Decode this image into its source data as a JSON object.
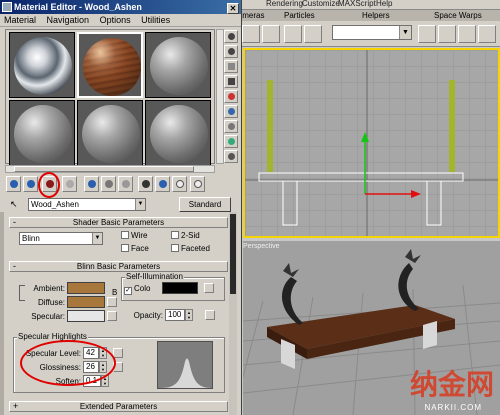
{
  "max": {
    "menubar": [
      "Rendering",
      "Customize",
      "MAXScript",
      "Help"
    ],
    "tabs": [
      "Cameras",
      "Particles",
      "Helpers",
      "Space Warps"
    ],
    "persp_label": "Perspective",
    "watermark_cn": "纳金网",
    "watermark_url": "NARKII.COM"
  },
  "material_editor": {
    "title": "Material Editor - Wood_Ashen",
    "menu": [
      "Material",
      "Navigation",
      "Options",
      "Utilities"
    ],
    "material_name": "Wood_Ashen",
    "material_type": "Standard",
    "shader_rollout": {
      "title": "Shader Basic Parameters",
      "shader": "Blinn",
      "wire": "Wire",
      "two_sided": "2-Sid",
      "face": "Face",
      "faceted": "Faceted"
    },
    "blinn_rollout": {
      "title": "Blinn Basic Parameters",
      "self_illum_title": "Self-Illumination",
      "color_label": "Colo",
      "ambient": "Ambient:",
      "diffuse": "Diffuse:",
      "specular": "Specular:",
      "opacity_label": "Opacity:",
      "opacity_value": "100",
      "lock_letter": "B",
      "map_letter": "M"
    },
    "specular_highlights": {
      "title": "Specular Highlights",
      "level_label": "Specular Level:",
      "level_value": "42",
      "gloss_label": "Glossiness:",
      "gloss_value": "26",
      "soften_label": "Soften:",
      "soften_value": "0.1"
    },
    "extended_rollout": {
      "title": "Extended Parameters"
    }
  },
  "colors": {
    "ambient": "#a8773c",
    "diffuse": "#a8773c",
    "specular": "#e6e6e6",
    "self_illum": "#000000",
    "annotation_red": "#e00000"
  }
}
